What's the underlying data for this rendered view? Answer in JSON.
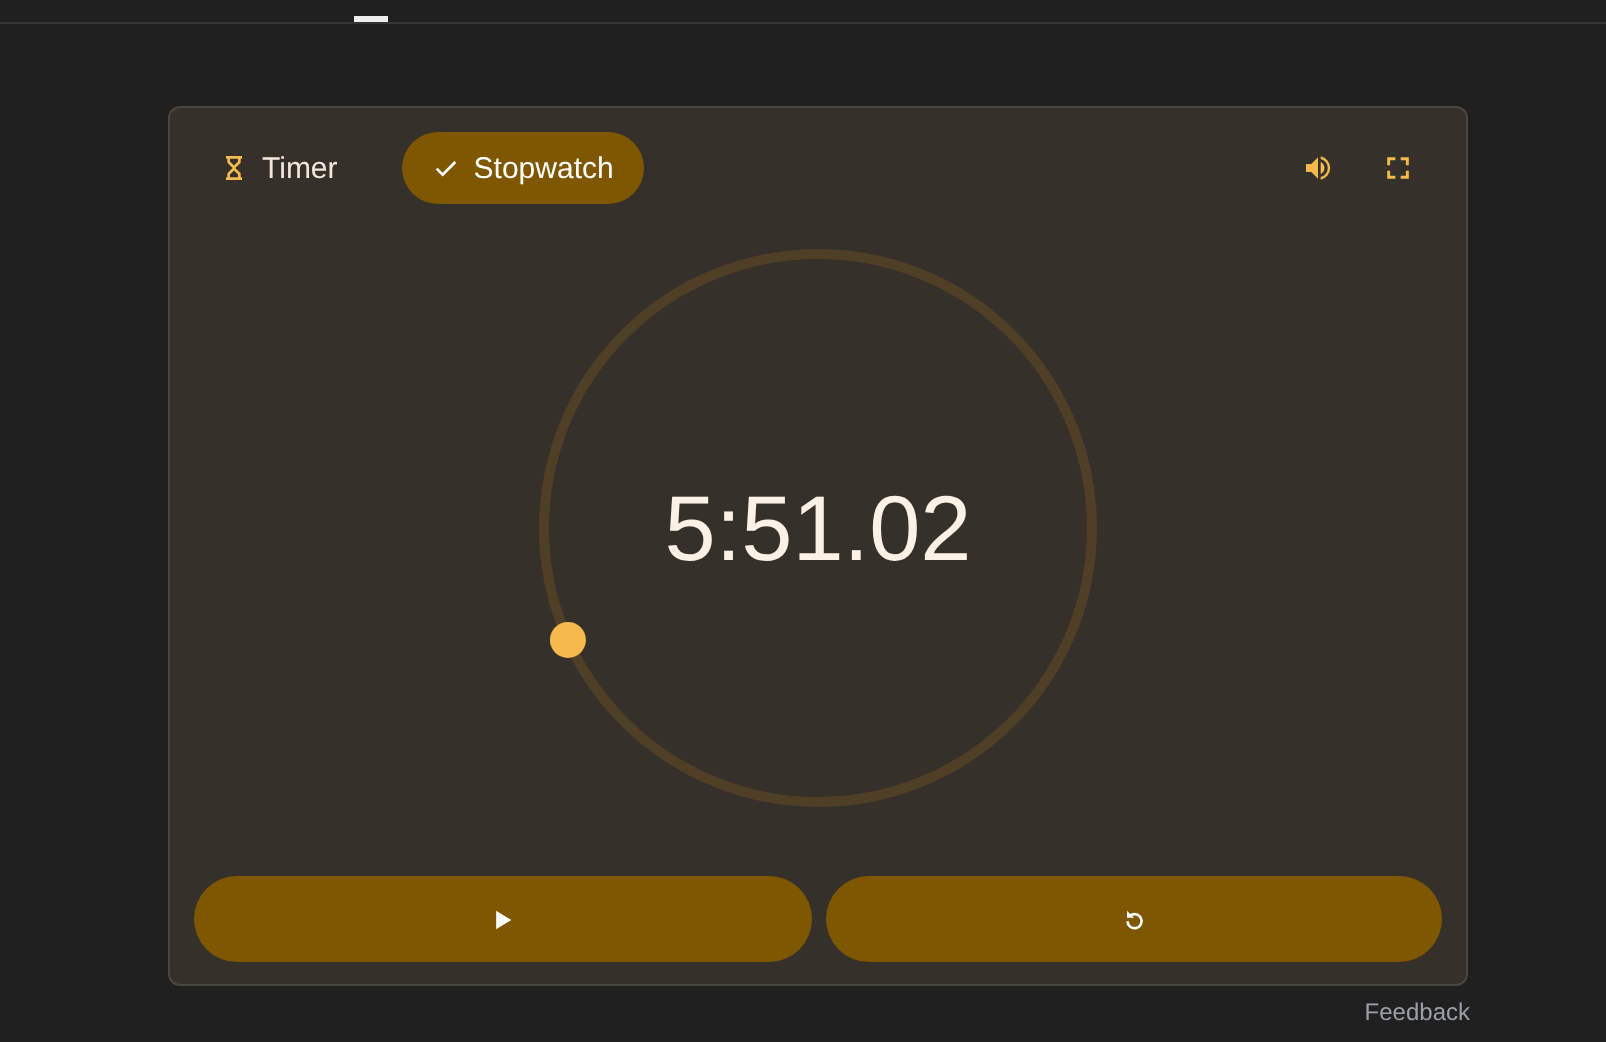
{
  "modes": [
    {
      "label": "Timer",
      "selected": false
    },
    {
      "label": "Stopwatch",
      "selected": true
    }
  ],
  "display": {
    "time": "5:51.02"
  },
  "footer": {
    "link": "Feedback"
  }
}
